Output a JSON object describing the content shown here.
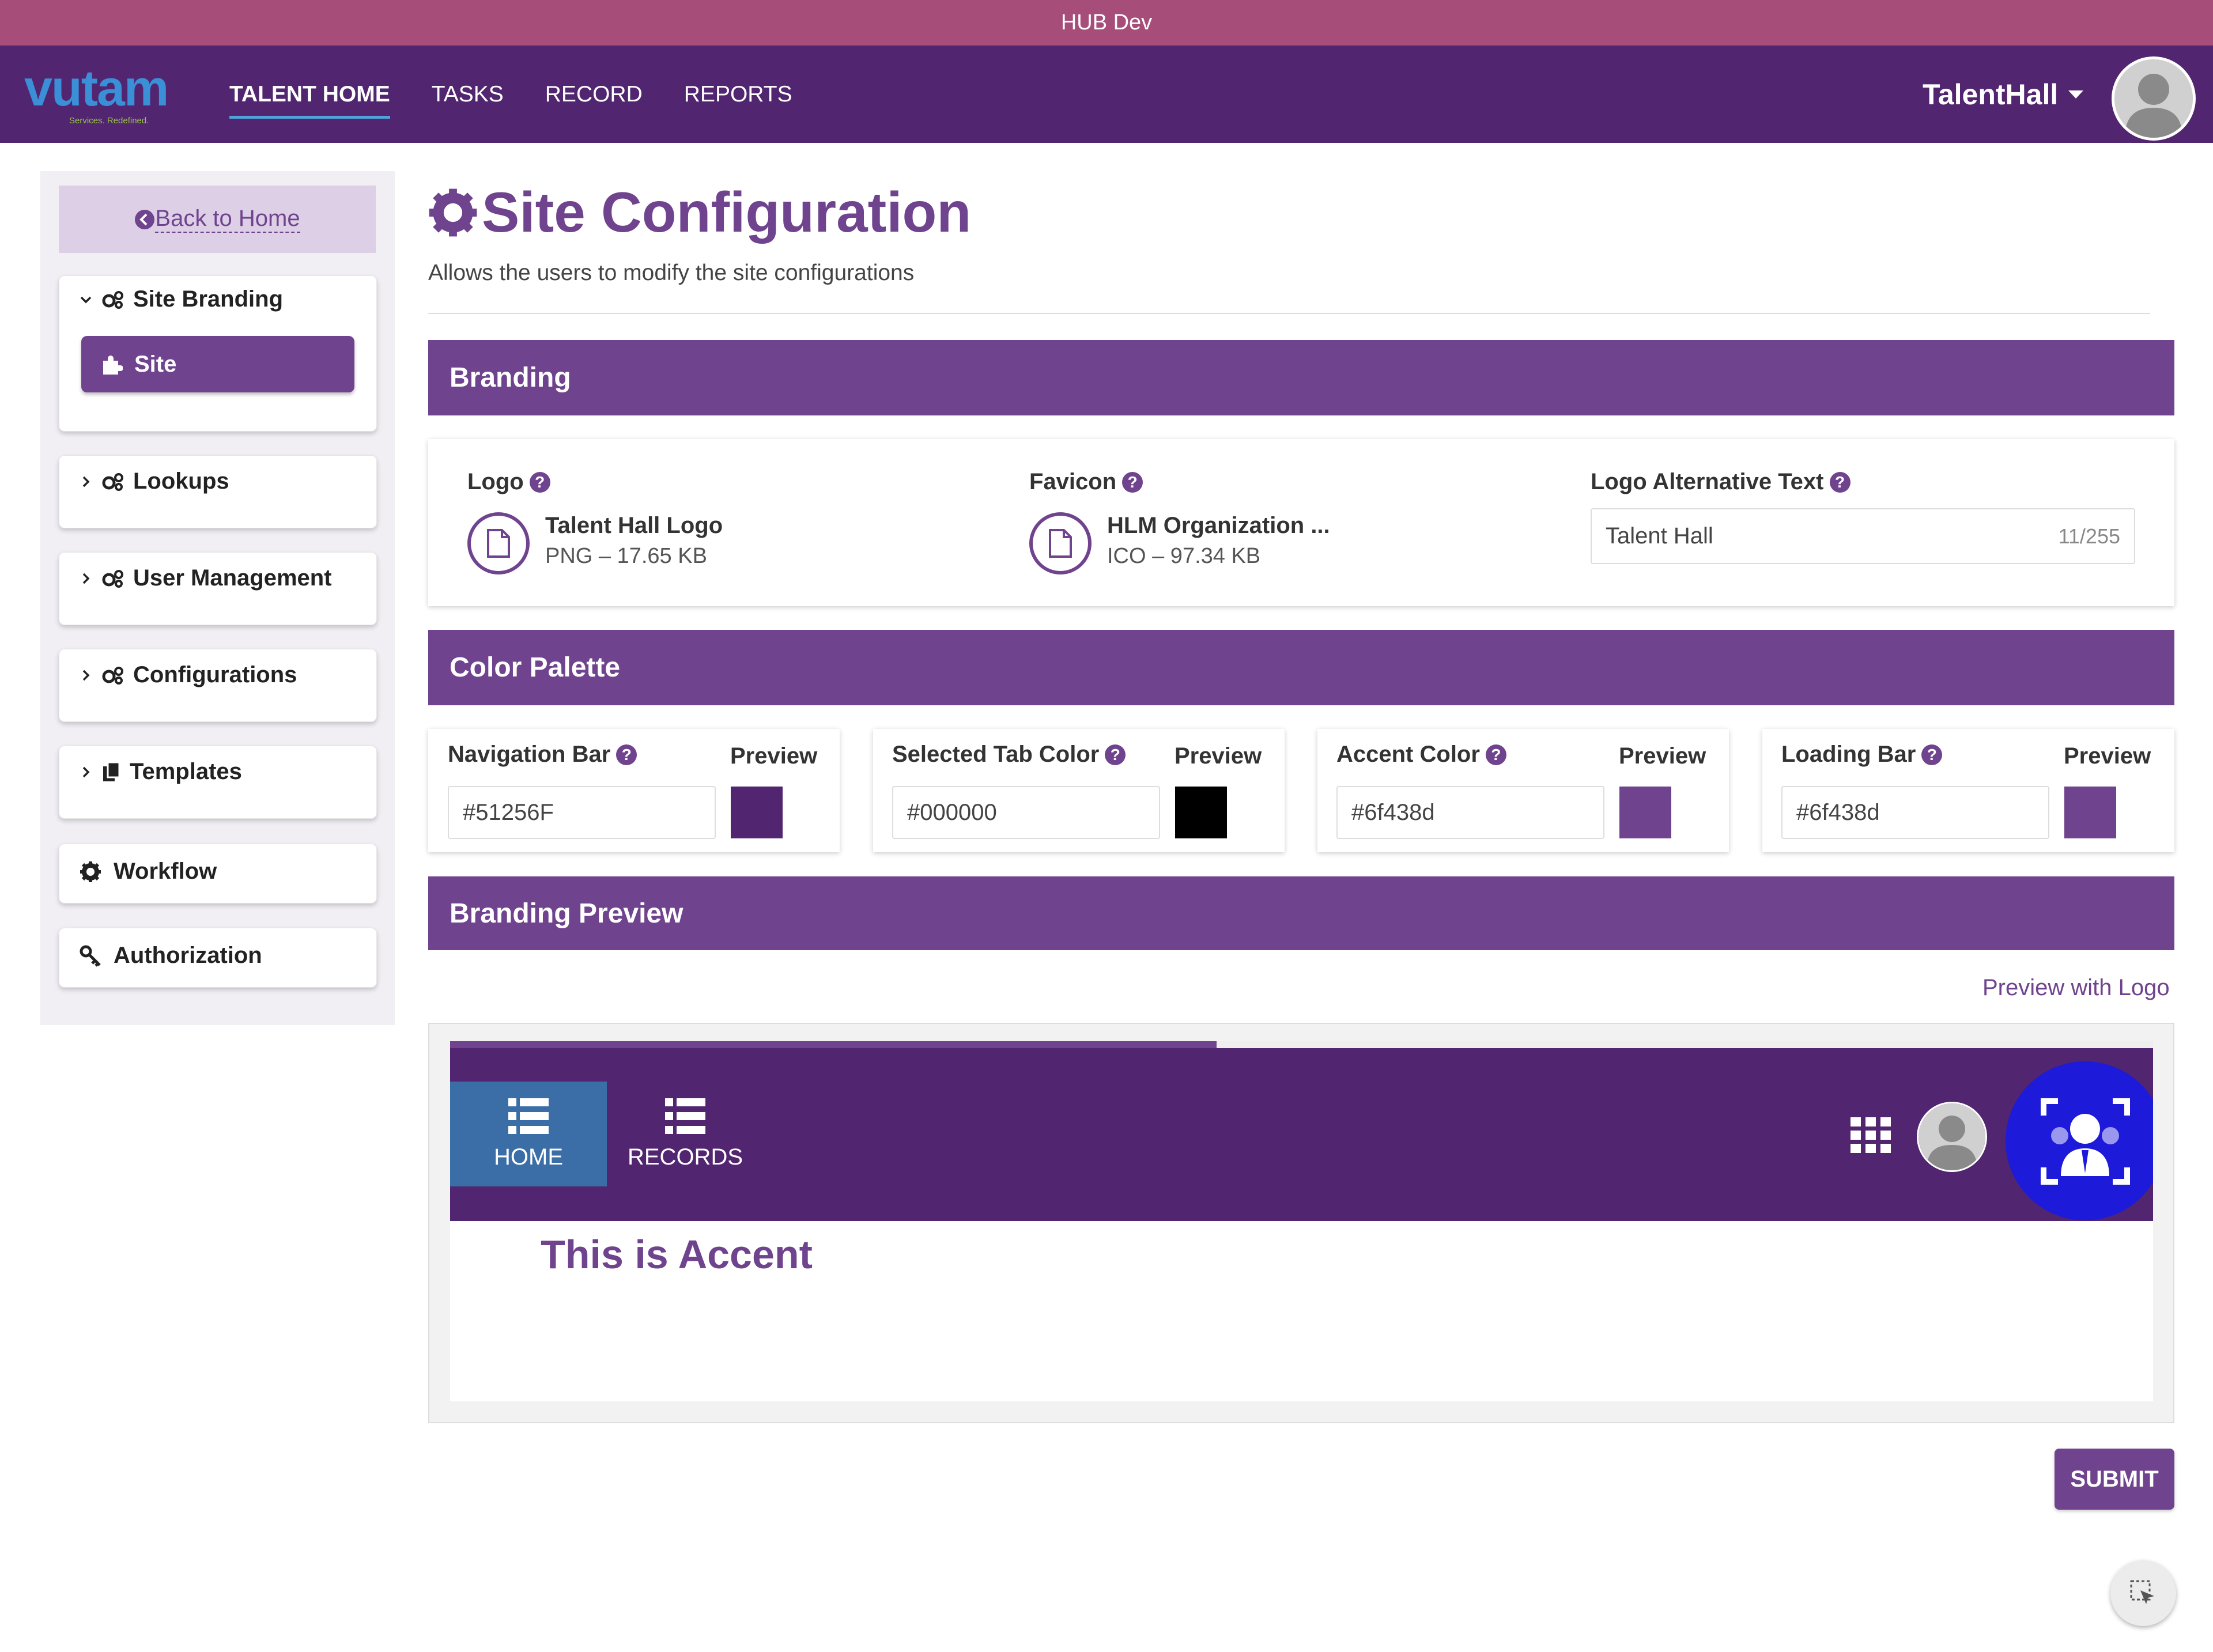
{
  "window": {
    "title": "HUB Dev"
  },
  "header": {
    "logo_text": "vutam",
    "logo_tagline": "Services. Redefined.",
    "nav": [
      "TALENT HOME",
      "TASKS",
      "RECORD",
      "REPORTS"
    ],
    "active_nav": "TALENT HOME",
    "user_name": "TalentHall"
  },
  "sidebar": {
    "back_label": "Back to Home",
    "groups": {
      "site_branding": "Site Branding",
      "site": "Site",
      "lookups": "Lookups",
      "user_management": "User Management",
      "configurations": "Configurations",
      "templates": "Templates",
      "workflow": "Workflow",
      "authorization": "Authorization"
    }
  },
  "page": {
    "title": "Site Configuration",
    "subtitle": "Allows the users to modify the site configurations"
  },
  "branding": {
    "header": "Branding",
    "logo": {
      "label": "Logo",
      "file_name": "Talent Hall Logo",
      "file_meta": "PNG – 17.65 KB"
    },
    "favicon": {
      "label": "Favicon",
      "file_name": "HLM Organization ...",
      "file_meta": "ICO – 97.34 KB"
    },
    "alt_text": {
      "label": "Logo Alternative Text",
      "value": "Talent Hall",
      "counter": "11/255"
    }
  },
  "palette": {
    "header": "Color Palette",
    "preview_label": "Preview",
    "items": [
      {
        "label": "Navigation Bar",
        "value": "#51256F",
        "color": "#51256f"
      },
      {
        "label": "Selected Tab Color",
        "value": "#000000",
        "color": "#000000"
      },
      {
        "label": "Accent Color",
        "value": "#6f438d",
        "color": "#6f438d"
      },
      {
        "label": "Loading Bar",
        "value": "#6f438d",
        "color": "#6f438d"
      }
    ]
  },
  "branding_preview": {
    "header": "Branding Preview",
    "link": "Preview with Logo",
    "tabs": [
      "HOME",
      "RECORDS"
    ],
    "accent_text": "This is Accent"
  },
  "actions": {
    "submit": "SUBMIT"
  },
  "colors": {
    "nav": "#51256f",
    "accent": "#6f438d",
    "titlebar": "#a64d7a",
    "selected_tab_preview": "#3b6ea7"
  }
}
